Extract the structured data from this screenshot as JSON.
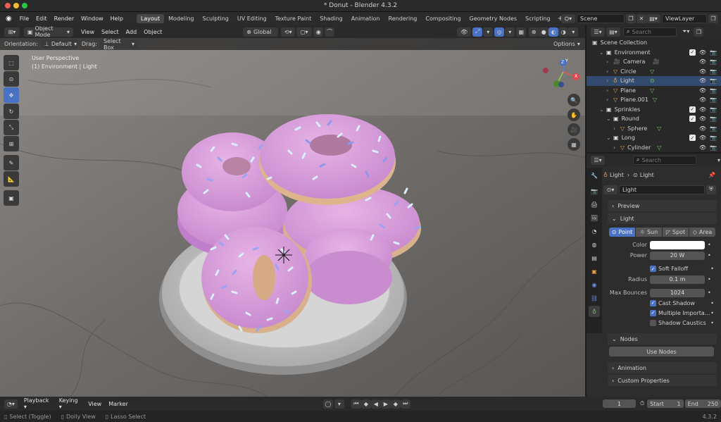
{
  "window": {
    "title": "* Donut - Blender 4.3.2"
  },
  "menu": [
    "File",
    "Edit",
    "Render",
    "Window",
    "Help"
  ],
  "workspaces": [
    "Layout",
    "Modeling",
    "Sculpting",
    "UV Editing",
    "Texture Paint",
    "Shading",
    "Animation",
    "Rendering",
    "Compositing",
    "Geometry Nodes",
    "Scripting"
  ],
  "scene": {
    "scene_name": "Scene",
    "view_layer": "ViewLayer"
  },
  "viewport_header": {
    "mode": "Object Mode",
    "menus": [
      "View",
      "Select",
      "Add",
      "Object"
    ],
    "transform": "Global"
  },
  "viewport_sub": {
    "orientation_label": "Orientation:",
    "orientation": "Default",
    "drag_label": "Drag:",
    "drag": "Select Box",
    "options": "Options"
  },
  "viewport": {
    "info_line1": "User Perspective",
    "info_line2": "(1) Environment | Light",
    "gizmo_z": "Z",
    "gizmo_y": "Y",
    "gizmo_x": "X"
  },
  "outliner": {
    "search_placeholder": "Search",
    "root": "Scene Collection",
    "rows": [
      {
        "label": "Environment",
        "indent": 1,
        "kind": "collection"
      },
      {
        "label": "Camera",
        "indent": 2,
        "kind": "camera"
      },
      {
        "label": "Circle",
        "indent": 2,
        "kind": "mesh"
      },
      {
        "label": "Light",
        "indent": 2,
        "kind": "light"
      },
      {
        "label": "Plane",
        "indent": 2,
        "kind": "mesh"
      },
      {
        "label": "Plane.001",
        "indent": 2,
        "kind": "mesh"
      },
      {
        "label": "Sprinkles",
        "indent": 1,
        "kind": "collection"
      },
      {
        "label": "Round",
        "indent": 2,
        "kind": "collection"
      },
      {
        "label": "Sphere",
        "indent": 3,
        "kind": "mesh"
      },
      {
        "label": "Long",
        "indent": 2,
        "kind": "collection"
      },
      {
        "label": "Cylinder",
        "indent": 3,
        "kind": "mesh"
      }
    ]
  },
  "properties": {
    "search_placeholder": "Search",
    "breadcrumb_object": "Light",
    "breadcrumb_data": "Light",
    "datablock": "Light",
    "panel_preview": "Preview",
    "panel_light": "Light",
    "light_types": [
      "Point",
      "Sun",
      "Spot",
      "Area"
    ],
    "color_label": "Color",
    "power_label": "Power",
    "power": "20 W",
    "soft_falloff": "Soft Falloff",
    "radius_label": "Radius",
    "radius": "0.1 m",
    "max_bounces_label": "Max Bounces",
    "max_bounces": "1024",
    "cast_shadow": "Cast Shadow",
    "multiple_importance": "Multiple Importa...",
    "shadow_caustics": "Shadow Caustics",
    "panel_nodes": "Nodes",
    "use_nodes": "Use Nodes",
    "panel_animation": "Animation",
    "panel_custom": "Custom Properties"
  },
  "timeline": {
    "menus": [
      "Playback",
      "Keying",
      "View",
      "Marker"
    ],
    "current_frame": "1",
    "start_label": "Start",
    "start": "1",
    "end_label": "End",
    "end": "250"
  },
  "statusbar": {
    "item1": "Select (Toggle)",
    "item2": "Dolly View",
    "item3": "Lasso Select",
    "version": "4.3.2"
  },
  "colors": {
    "accent": "#4a72c4",
    "frosting": "#d9a3dc",
    "traffic_red": "#ee5f57",
    "traffic_yellow": "#f6bc2f",
    "traffic_green": "#29c73f"
  }
}
